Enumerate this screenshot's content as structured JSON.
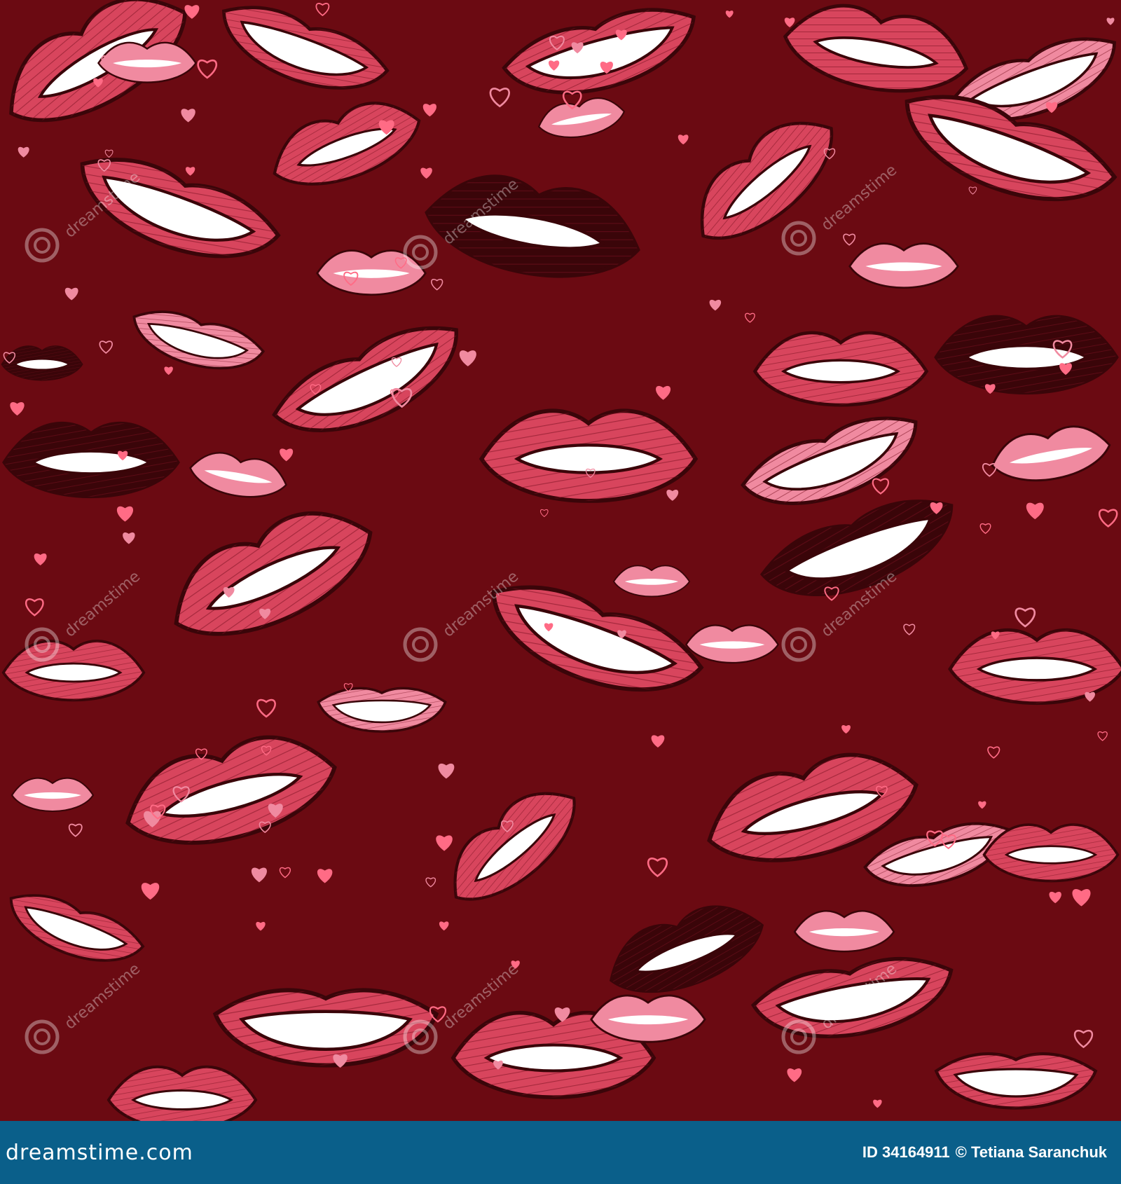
{
  "image": {
    "subject": "seamless-lips-pattern",
    "palette": {
      "background": "#6b0a12",
      "lip_red": "#d8455d",
      "lip_pink": "#f08aa0",
      "lip_dark": "#3a0509",
      "teeth": "#ffffff",
      "outline": "#3a0509",
      "heart": "#ff6b85",
      "footer": "#0a5f8a"
    },
    "watermark_text": "dreamstime"
  },
  "footer": {
    "site": "dreamstime.com",
    "id": "ID 34164911",
    "copyright": "© Tetiana Saranchuk"
  }
}
